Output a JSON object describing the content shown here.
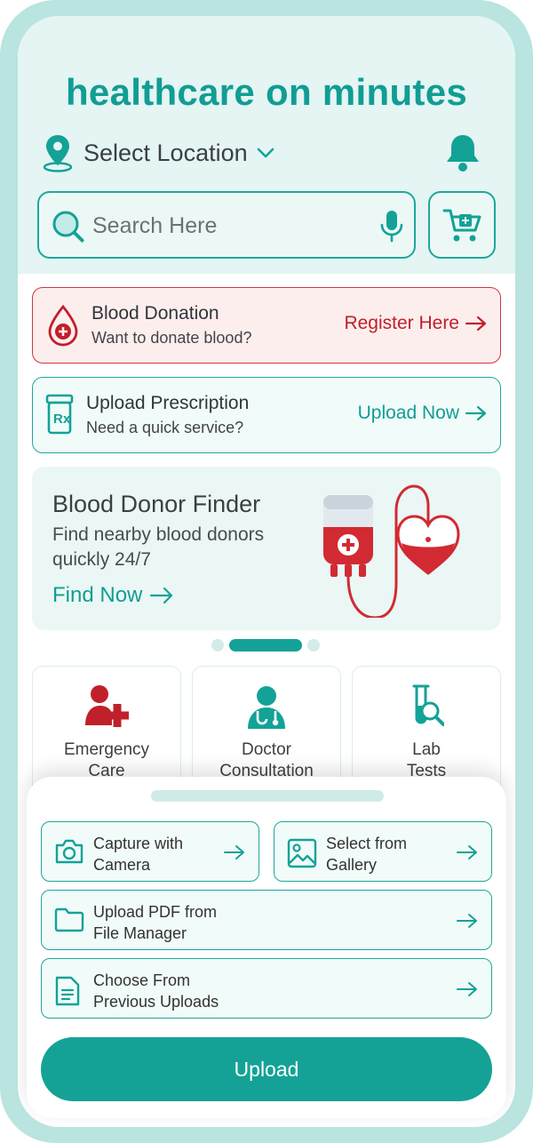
{
  "header": {
    "title": "healthcare on minutes",
    "location_label": "Select Location",
    "search_placeholder": "Search Here"
  },
  "cards": {
    "blood_donation": {
      "title": "Blood Donation",
      "subtitle": "Want to donate blood?",
      "cta": "Register Here"
    },
    "upload_prescription": {
      "title": "Upload Prescription",
      "subtitle": "Need a quick service?",
      "cta": "Upload Now"
    }
  },
  "banner": {
    "title": "Blood Donor Finder",
    "subtitle": "Find nearby blood donors quickly 24/7",
    "cta": "Find Now"
  },
  "carousel": {
    "count": 3,
    "active_index": 1
  },
  "services": [
    {
      "label_line1": "Emergency",
      "label_line2": "Care",
      "icon": "emergency-care-icon"
    },
    {
      "label_line1": "Doctor",
      "label_line2": "Consultation",
      "icon": "doctor-icon"
    },
    {
      "label_line1": "Lab",
      "label_line2": "Tests",
      "icon": "lab-test-icon"
    }
  ],
  "sheet": {
    "options": [
      {
        "line1": "Capture with",
        "line2": "Camera",
        "icon": "camera-icon"
      },
      {
        "line1": "Select from",
        "line2": "Gallery",
        "icon": "gallery-icon"
      },
      {
        "line1": "Upload PDF from",
        "line2": "File Manager",
        "icon": "folder-icon"
      },
      {
        "line1": "Choose From",
        "line2": "Previous Uploads",
        "icon": "document-icon"
      }
    ],
    "upload_label": "Upload"
  },
  "colors": {
    "primary": "#14a297",
    "primary_light": "#e4f5f3",
    "danger": "#c0202a",
    "text": "#3b3f44"
  }
}
